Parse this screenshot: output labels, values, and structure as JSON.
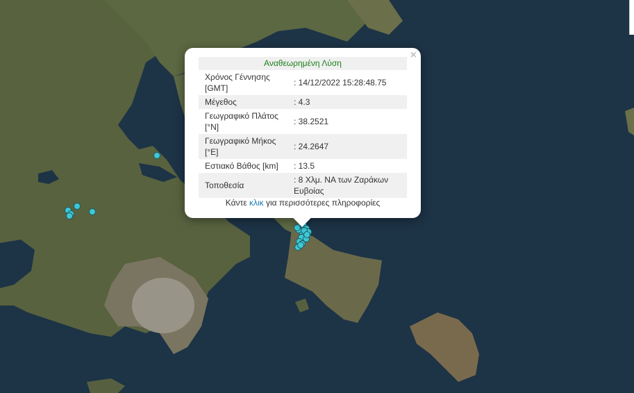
{
  "popup": {
    "title": "Αναθεωρημένη Λύση",
    "close_symbol": "×",
    "rows": [
      {
        "label": "Χρόνος Γέννησης [GMT]",
        "value": ": 14/12/2022 15:28:48.75"
      },
      {
        "label": "Μέγεθος",
        "value": ": 4.3"
      },
      {
        "label": "Γεωγραφικό Πλάτος [°N]",
        "value": ": 38.2521"
      },
      {
        "label": "Γεωγραφικό Μήκος [°E]",
        "value": ": 24.2647"
      },
      {
        "label": "Εστιακό Βάθος [km]",
        "value": ": 13.5"
      },
      {
        "label": "Τοποθεσία",
        "value": ": 8 Χλμ. ΝΑ των Ζαράκων Ευβοίας"
      }
    ],
    "more_prefix": "Κάντε",
    "more_link": "κλικ",
    "more_suffix": "για περισσότερες πληροφορίες"
  },
  "colors": {
    "sea": "#1d3346",
    "land": "#5a6340",
    "city": "#9d9a8f",
    "marker_fill": "#3ec8d4",
    "marker_stroke": "#1a5a66",
    "title_green": "#1a7f1a",
    "link": "#1a7ab3"
  },
  "markers": {
    "icon": "earthquake-marker-icon",
    "count": 22
  }
}
